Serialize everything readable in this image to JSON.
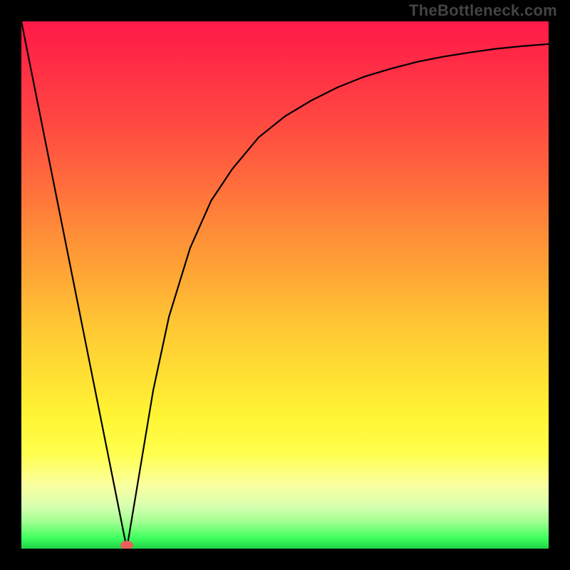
{
  "watermark": "TheBottleneck.com",
  "chart_data": {
    "type": "line",
    "title": "",
    "xlabel": "",
    "ylabel": "",
    "xlim": [
      0,
      100
    ],
    "ylim": [
      0,
      100
    ],
    "grid": false,
    "legend": false,
    "background_gradient": {
      "direction": "vertical",
      "stops": [
        {
          "pos": 0,
          "color": "#ff1a47"
        },
        {
          "pos": 50,
          "color": "#ffad35"
        },
        {
          "pos": 82,
          "color": "#ffff4e"
        },
        {
          "pos": 100,
          "color": "#1fd248"
        }
      ]
    },
    "series": [
      {
        "name": "bottleneck-curve",
        "color": "#000000",
        "x": [
          0,
          5,
          10,
          15,
          18,
          20,
          22,
          25,
          28,
          32,
          36,
          40,
          45,
          50,
          55,
          60,
          65,
          70,
          75,
          80,
          85,
          90,
          95,
          100
        ],
        "y": [
          100,
          75,
          50,
          25,
          10,
          0,
          12,
          30,
          44,
          57,
          66,
          72,
          78,
          82,
          85,
          87.5,
          89.5,
          91,
          92.3,
          93.3,
          94.1,
          94.8,
          95.3,
          95.7
        ]
      }
    ],
    "min_marker": {
      "x": 20,
      "y": 0,
      "color": "#e95f5a"
    }
  }
}
